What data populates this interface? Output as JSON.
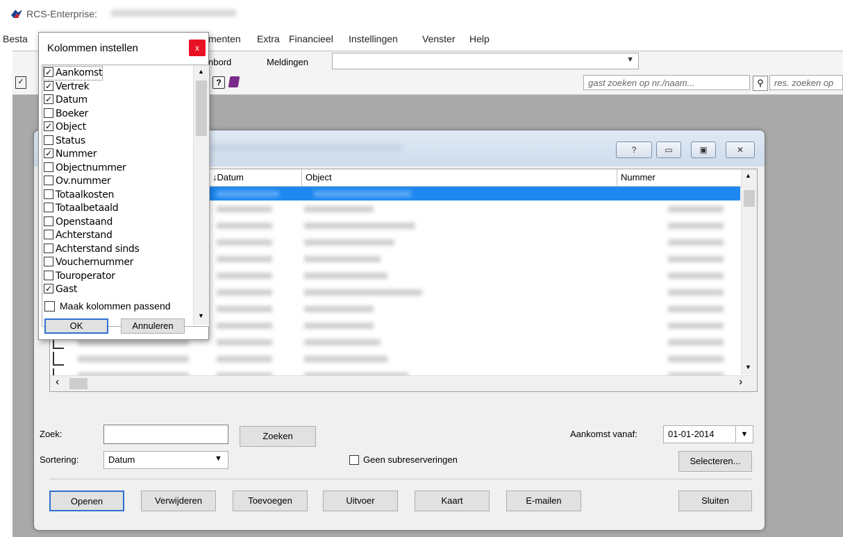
{
  "window": {
    "title": "RCS-Enterprise:"
  },
  "menu": {
    "items": [
      "Besta",
      "menten",
      "Extra",
      "Financieel",
      "Instellingen",
      "Venster",
      "Help"
    ]
  },
  "toolbar": {
    "tabs": [
      "nbord",
      "Meldingen"
    ],
    "guest_search_placeholder": "gast zoeken op nr./naam...",
    "res_search_placeholder": "res. zoeken op"
  },
  "popup": {
    "title": "Kolommen instellen",
    "close_label": "x",
    "columns": [
      {
        "label": "Aankomst",
        "checked": true
      },
      {
        "label": "Vertrek",
        "checked": true
      },
      {
        "label": "Datum",
        "checked": true
      },
      {
        "label": "Boeker",
        "checked": false
      },
      {
        "label": "Object",
        "checked": true
      },
      {
        "label": "Status",
        "checked": false
      },
      {
        "label": "Nummer",
        "checked": true
      },
      {
        "label": "Objectnummer",
        "checked": false
      },
      {
        "label": "Ov.nummer",
        "checked": false
      },
      {
        "label": "Totaalkosten",
        "checked": false
      },
      {
        "label": "Totaalbetaald",
        "checked": false
      },
      {
        "label": "Openstaand",
        "checked": false
      },
      {
        "label": "Achterstand",
        "checked": false
      },
      {
        "label": "Achterstand sinds",
        "checked": false
      },
      {
        "label": "Vouchernummer",
        "checked": false
      },
      {
        "label": "Touroperator",
        "checked": false
      },
      {
        "label": "Gast",
        "checked": true
      }
    ],
    "fit_columns_label": "Maak kolommen passend",
    "ok_label": "OK",
    "cancel_label": "Annuleren"
  },
  "grid": {
    "headers": [
      "↓Datum",
      "Object",
      "Nummer"
    ]
  },
  "form": {
    "search_label": "Zoek:",
    "search_value": "",
    "search_button": "Zoeken",
    "sort_label": "Sortering:",
    "sort_value": "Datum",
    "no_subres_label": "Geen subreserveringen",
    "arrival_label": "Aankomst vanaf:",
    "arrival_value": "01-01-2014",
    "select_button": "Selecteren..."
  },
  "buttons": {
    "open": "Openen",
    "delete": "Verwijderen",
    "add": "Toevoegen",
    "export": "Uitvoer",
    "map": "Kaart",
    "email": "E-mailen",
    "close": "Sluiten"
  },
  "icons": {
    "help_glyph": "?",
    "minimize_glyph": "▭",
    "maximize_glyph": "▣",
    "close_glyph": "✕",
    "checkmark_glyph": "✓",
    "scroll_up": "▲",
    "scroll_down": "▼",
    "scroll_left": "‹",
    "scroll_right": "›"
  }
}
